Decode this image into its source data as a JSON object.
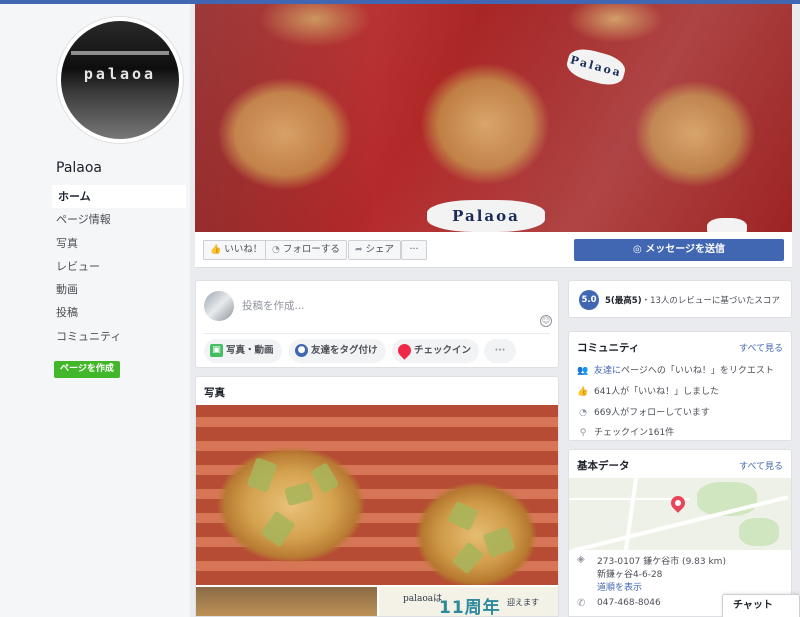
{
  "sidebar": {
    "logo_text": "palaoa",
    "page_name": "Palaoa",
    "nav": [
      {
        "label": "ホーム",
        "active": true
      },
      {
        "label": "ページ情報"
      },
      {
        "label": "写真"
      },
      {
        "label": "レビュー"
      },
      {
        "label": "動画"
      },
      {
        "label": "投稿"
      },
      {
        "label": "コミュニティ"
      }
    ],
    "create_page": "ページを作成"
  },
  "cover": {
    "tag_text": "Palaoa",
    "tag_text_small": "Palaoa"
  },
  "actions": {
    "like": "いいね！",
    "follow": "フォローする",
    "share": "シェア",
    "more": "···",
    "message": "メッセージを送信"
  },
  "composer": {
    "placeholder": "投稿を作成...",
    "photo_video": "写真・動画",
    "tag_friends": "友達をタグ付け",
    "checkin": "チェックイン",
    "more": "···"
  },
  "photos": {
    "title": "写真",
    "sub_handwriting": "palaoaは",
    "sub_big": "11周年",
    "sub_small": "迎えます"
  },
  "rating": {
    "score": "5.0",
    "score_text": "5(最高5)",
    "summary": "・13人のレビューに基づいたスコア"
  },
  "community": {
    "title": "コミュニティ",
    "see_all": "すべて見る",
    "invite_link": "友達に",
    "invite_text": "ページへの「いいね！」をリクエスト",
    "likes": "641人が「いいね！」しました",
    "follows": "669人がフォローしています",
    "checkins": "チェックイン161件"
  },
  "basic": {
    "title": "基本データ",
    "see_all": "すべて見る",
    "address_line1": "273-0107 鎌ケ谷市 (9.83 km)",
    "address_line2": "新鎌ヶ谷4-6-28",
    "directions": "道順を表示",
    "phone": "047-468-8046"
  },
  "chat": {
    "label": "チャット"
  },
  "colors": {
    "brand": "#4267b2",
    "create_page_button": "#42b72a"
  }
}
